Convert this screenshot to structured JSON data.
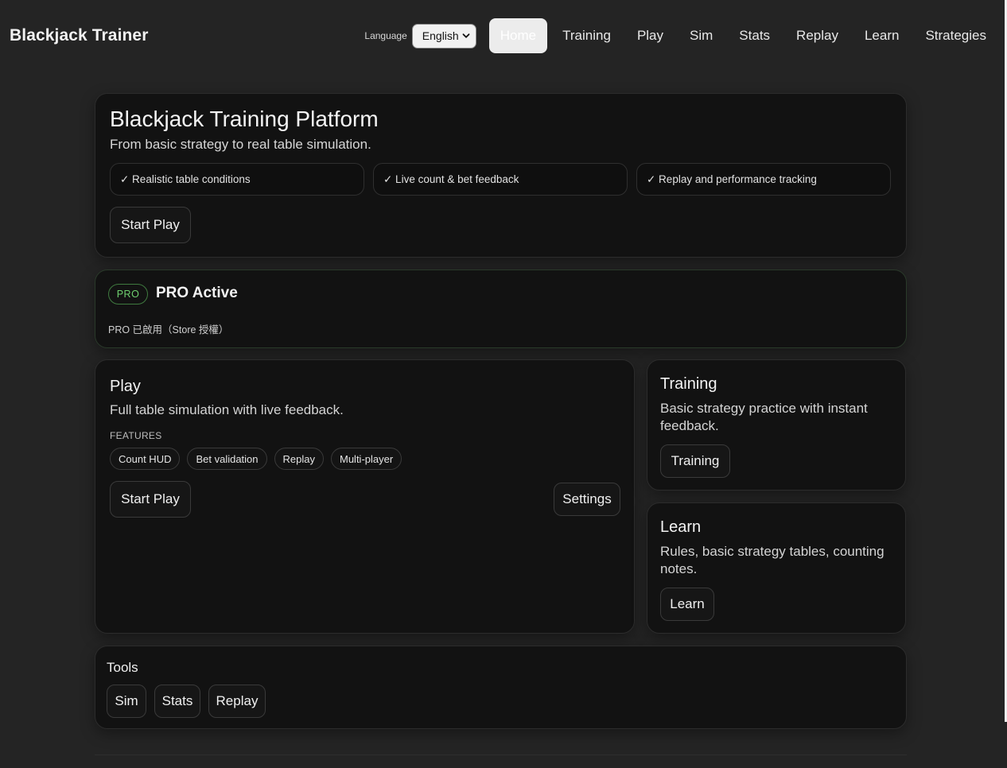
{
  "app": {
    "brand": "Blackjack Trainer"
  },
  "header": {
    "language_label": "Language",
    "language_value": "English",
    "nav": [
      {
        "id": "home",
        "label": "Home",
        "active": true
      },
      {
        "id": "training",
        "label": "Training"
      },
      {
        "id": "play",
        "label": "Play"
      },
      {
        "id": "sim",
        "label": "Sim"
      },
      {
        "id": "stats",
        "label": "Stats"
      },
      {
        "id": "replay",
        "label": "Replay"
      },
      {
        "id": "learn",
        "label": "Learn"
      },
      {
        "id": "strategies",
        "label": "Strategies"
      }
    ]
  },
  "hero": {
    "title": "Blackjack Training Platform",
    "subtitle": "From basic strategy to real table simulation.",
    "features": [
      "✓ Realistic table conditions",
      "✓ Live count & bet feedback",
      "✓ Replay and performance tracking"
    ],
    "cta": "Start Play"
  },
  "pro": {
    "badge": "PRO",
    "title": "PRO Active",
    "note": "PRO 已啟用（Store 授權）"
  },
  "play_card": {
    "title": "Play",
    "description": "Full table simulation with live feedback.",
    "features_label": "FEATURES",
    "tags": [
      "Count HUD",
      "Bet validation",
      "Replay",
      "Multi-player"
    ],
    "start_label": "Start Play",
    "settings_label": "Settings"
  },
  "training_card": {
    "title": "Training",
    "description": "Basic strategy practice with instant feedback.",
    "button": "Training"
  },
  "learn_card": {
    "title": "Learn",
    "description": "Rules, basic strategy tables, counting notes.",
    "button": "Learn"
  },
  "tools": {
    "title": "Tools",
    "buttons": [
      "Sim",
      "Stats",
      "Replay"
    ]
  }
}
